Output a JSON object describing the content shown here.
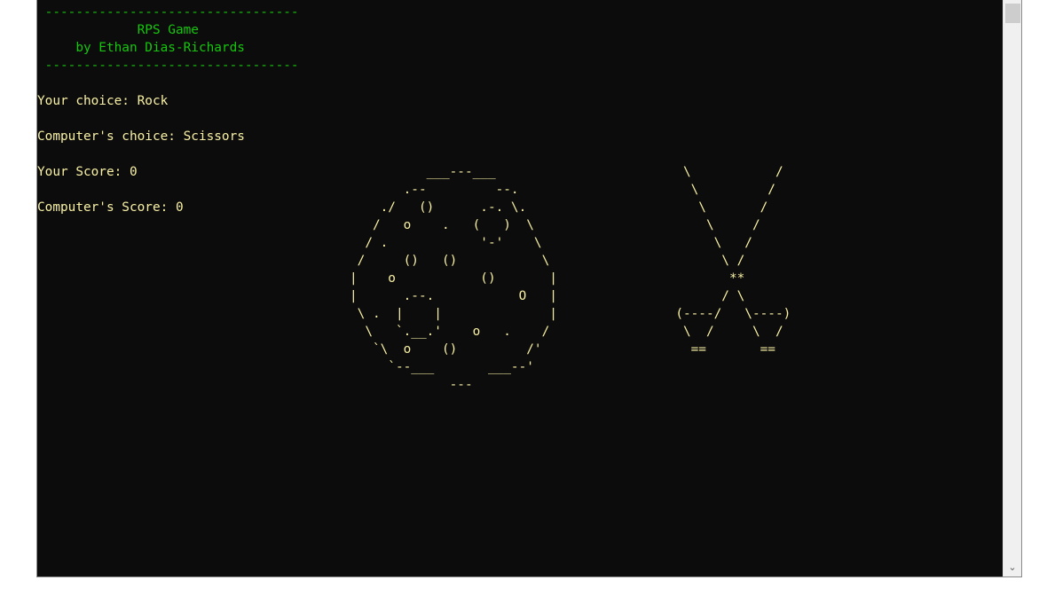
{
  "header": {
    "rule_top": " ---------------------------------",
    "title": "             RPS Game",
    "author": "     by Ethan Dias-Richards",
    "rule_bottom": " ---------------------------------"
  },
  "status": {
    "your_choice": "Your choice: Rock",
    "computer_choice": "Computer's choice: Scissors",
    "your_score": "Your Score: 0",
    "computer_score": "Computer's Score: 0"
  },
  "art": {
    "rock": "             ___---___\n          .--         --.\n       ./   ()      .-. \\.\n      /   o    .   (   )  \\\n     / .            '-'    \\\n    /     ()   ()           \\\n   |    o           ()       |\n   |      .--.           O   |\n    \\ .  |    |              |\n     \\   `.__.'    o   .    /\n      `\\  o    ()         /'\n        `--___       ___--'\n                ---",
    "scissors": "      \\           /\n       \\         /\n        \\       /\n         \\     /\n          \\   /\n           \\ /\n            **\n           / \\\n     (----/   \\----)\n      \\  /     \\  /\n       ==       =="
  },
  "scrollbar": {
    "down_arrow": "⌄"
  }
}
